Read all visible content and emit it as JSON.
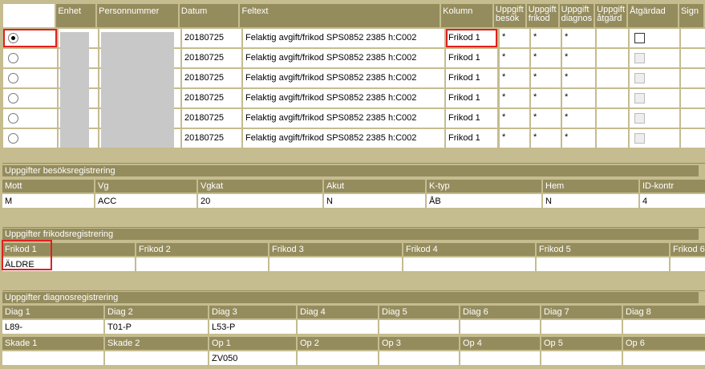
{
  "main_table": {
    "headers": {
      "enhet": "Enhet",
      "personnummer": "Personnummer",
      "datum": "Datum",
      "feltext": "Feltext",
      "kolumn": "Kolumn",
      "uppgift_besok_1": "Uppgift",
      "uppgift_besok_2": "besök",
      "uppgift_frikod_1": "Uppgift",
      "uppgift_frikod_2": "frikod",
      "uppgift_diagnos_1": "Uppgift",
      "uppgift_diagnos_2": "diagnos",
      "uppgift_atgard_1": "Uppgift",
      "uppgift_atgard_2": "åtgärd",
      "atgardad": "Åtgärdad",
      "sign": "Sign"
    },
    "rows": [
      {
        "datum": "20180725",
        "feltext": "Felaktig avgift/frikod SPS0852 2385 h:C002",
        "kolumn": "Frikod 1",
        "besok": "*",
        "frikod": "*",
        "diagnos": "*"
      },
      {
        "datum": "20180725",
        "feltext": "Felaktig avgift/frikod SPS0852 2385 h:C002",
        "kolumn": "Frikod 1",
        "besok": "*",
        "frikod": "*",
        "diagnos": "*"
      },
      {
        "datum": "20180725",
        "feltext": "Felaktig avgift/frikod SPS0852 2385 h:C002",
        "kolumn": "Frikod 1",
        "besok": "*",
        "frikod": "*",
        "diagnos": "*"
      },
      {
        "datum": "20180725",
        "feltext": "Felaktig avgift/frikod SPS0852 2385 h:C002",
        "kolumn": "Frikod 1",
        "besok": "*",
        "frikod": "*",
        "diagnos": "*"
      },
      {
        "datum": "20180725",
        "feltext": "Felaktig avgift/frikod SPS0852 2385 h:C002",
        "kolumn": "Frikod 1",
        "besok": "*",
        "frikod": "*",
        "diagnos": "*"
      },
      {
        "datum": "20180725",
        "feltext": "Felaktig avgift/frikod SPS0852 2385 h:C002",
        "kolumn": "Frikod 1",
        "besok": "*",
        "frikod": "*",
        "diagnos": "*"
      }
    ]
  },
  "besok": {
    "title": "Uppgifter besöksregistrering",
    "headers": [
      "Mott",
      "Vg",
      "Vgkat",
      "Akut",
      "K-typ",
      "Hem",
      "ID-kontr"
    ],
    "values": [
      "M",
      "ACC",
      "20",
      "N",
      "ÅB",
      "N",
      "4"
    ]
  },
  "frikod": {
    "title": "Uppgifter frikodsregistrering",
    "headers": [
      "Frikod 1",
      "Frikod 2",
      "Frikod 3",
      "Frikod 4",
      "Frikod 5",
      "Frikod 6"
    ],
    "values": [
      "ÄLDRE",
      "",
      "",
      "",
      "",
      ""
    ]
  },
  "diagnos": {
    "title": "Uppgifter diagnosregistrering",
    "diag_headers": [
      "Diag 1",
      "Diag 2",
      "Diag 3",
      "Diag 4",
      "Diag 5",
      "Diag 6",
      "Diag 7",
      "Diag 8"
    ],
    "diag_values": [
      "L89-",
      "T01-P",
      "L53-P",
      "",
      "",
      "",
      "",
      ""
    ],
    "op_headers": [
      "Skade 1",
      "Skade 2",
      "Op 1",
      "Op 2",
      "Op 3",
      "Op 4",
      "Op 5",
      "Op 6"
    ],
    "op_values": [
      "",
      "",
      "ZV050",
      "",
      "",
      "",
      "",
      ""
    ]
  },
  "colors": {
    "header_bg": "#958c5e",
    "page_bg": "#c5bc8f",
    "highlight": "#e02020"
  }
}
